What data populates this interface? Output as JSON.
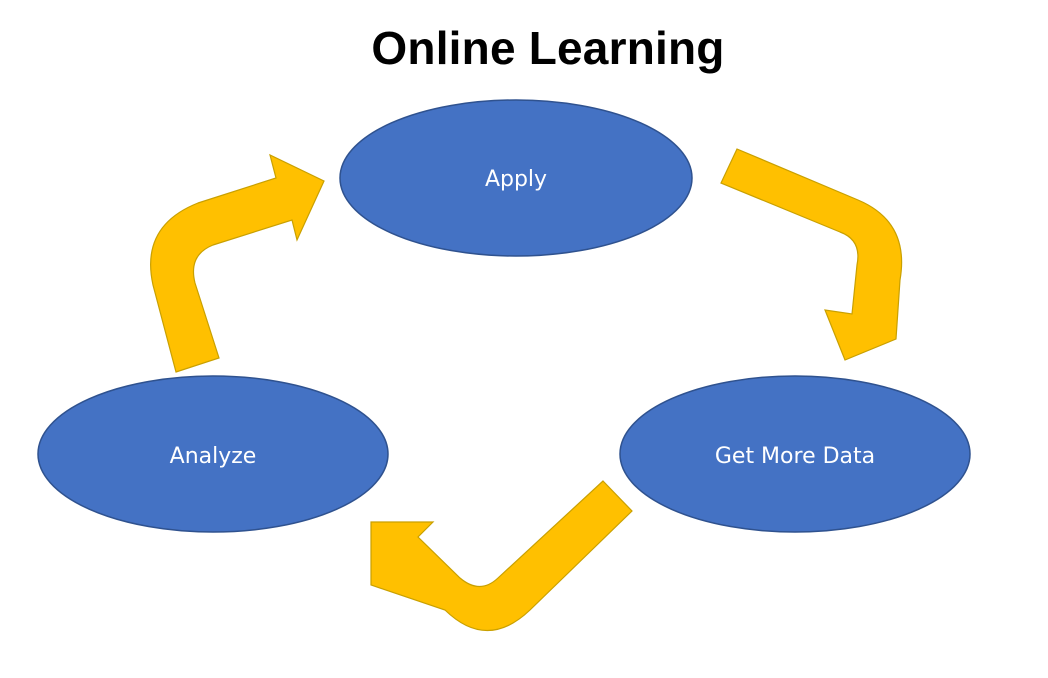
{
  "title": "Online Learning",
  "nodes": [
    {
      "id": "apply",
      "label": "Apply"
    },
    {
      "id": "get-more-data",
      "label": "Get More Data"
    },
    {
      "id": "analyze",
      "label": "Analyze"
    }
  ],
  "colors": {
    "node_fill": "#4472C4",
    "node_stroke": "#2F528F",
    "arrow_fill": "#FFC000",
    "arrow_stroke": "#C9A000",
    "text": "#FFFFFF",
    "title": "#000000"
  }
}
